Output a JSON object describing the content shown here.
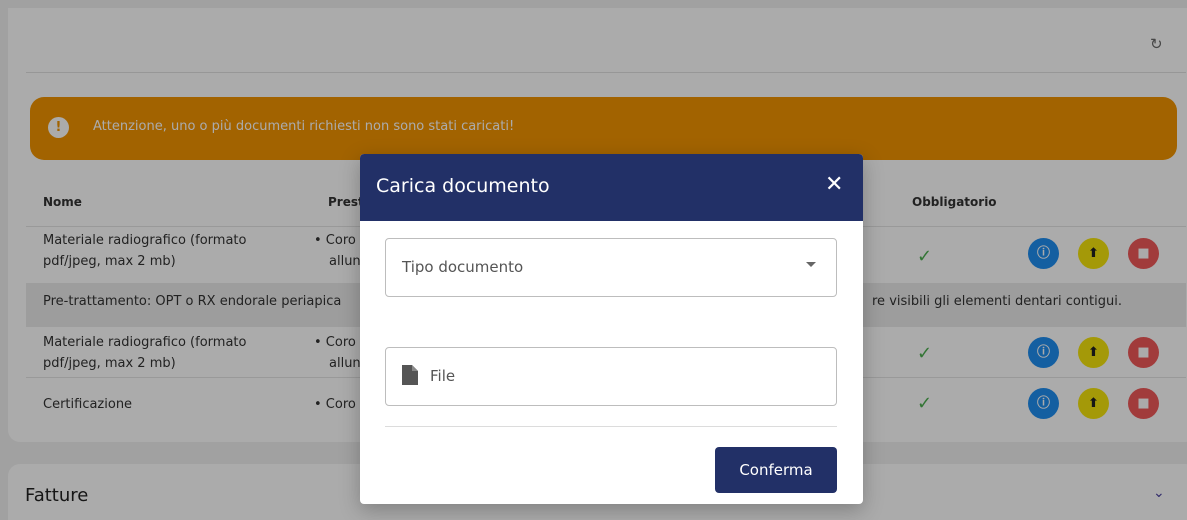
{
  "alert": {
    "text": "Attenzione, uno o più documenti richiesti non sono stati caricati!",
    "icon": "!"
  },
  "table": {
    "headers": {
      "nome": "Nome",
      "prest": "Prest",
      "obbligatorio": "Obbligatorio"
    },
    "rows": [
      {
        "nome": "Materiale radiografico (formato pdf/jpeg, max 2 mb)",
        "prest_line1": "• Coro",
        "prest_line2": "allun"
      },
      {
        "nome": "Materiale radiografico (formato pdf/jpeg, max 2 mb)",
        "prest_line1": "• Coro",
        "prest_line2": "allun"
      },
      {
        "nome": "Certificazione",
        "prest_line1": "• Coro"
      }
    ],
    "note_left": "Pre-trattamento: OPT o RX endorale periapica",
    "note_right": "re visibili gli elementi dentari contigui.",
    "check_glyph": "✓",
    "info_glyph": "ⓘ",
    "upload_glyph": "⬆",
    "delete_glyph": "■"
  },
  "section": {
    "fatture": "Fatture",
    "chevron": "⌄"
  },
  "refresh_glyph": "↻",
  "modal": {
    "title": "Carica documento",
    "close": "✕",
    "tipo_placeholder": "Tipo documento",
    "file_placeholder": "File",
    "confirm": "Conferma"
  },
  "colors": {
    "primary": "#223067",
    "alert": "#f29400",
    "info": "#1f8ef1",
    "upload": "#f5e50d",
    "delete": "#f05858",
    "check": "#4caf50"
  }
}
